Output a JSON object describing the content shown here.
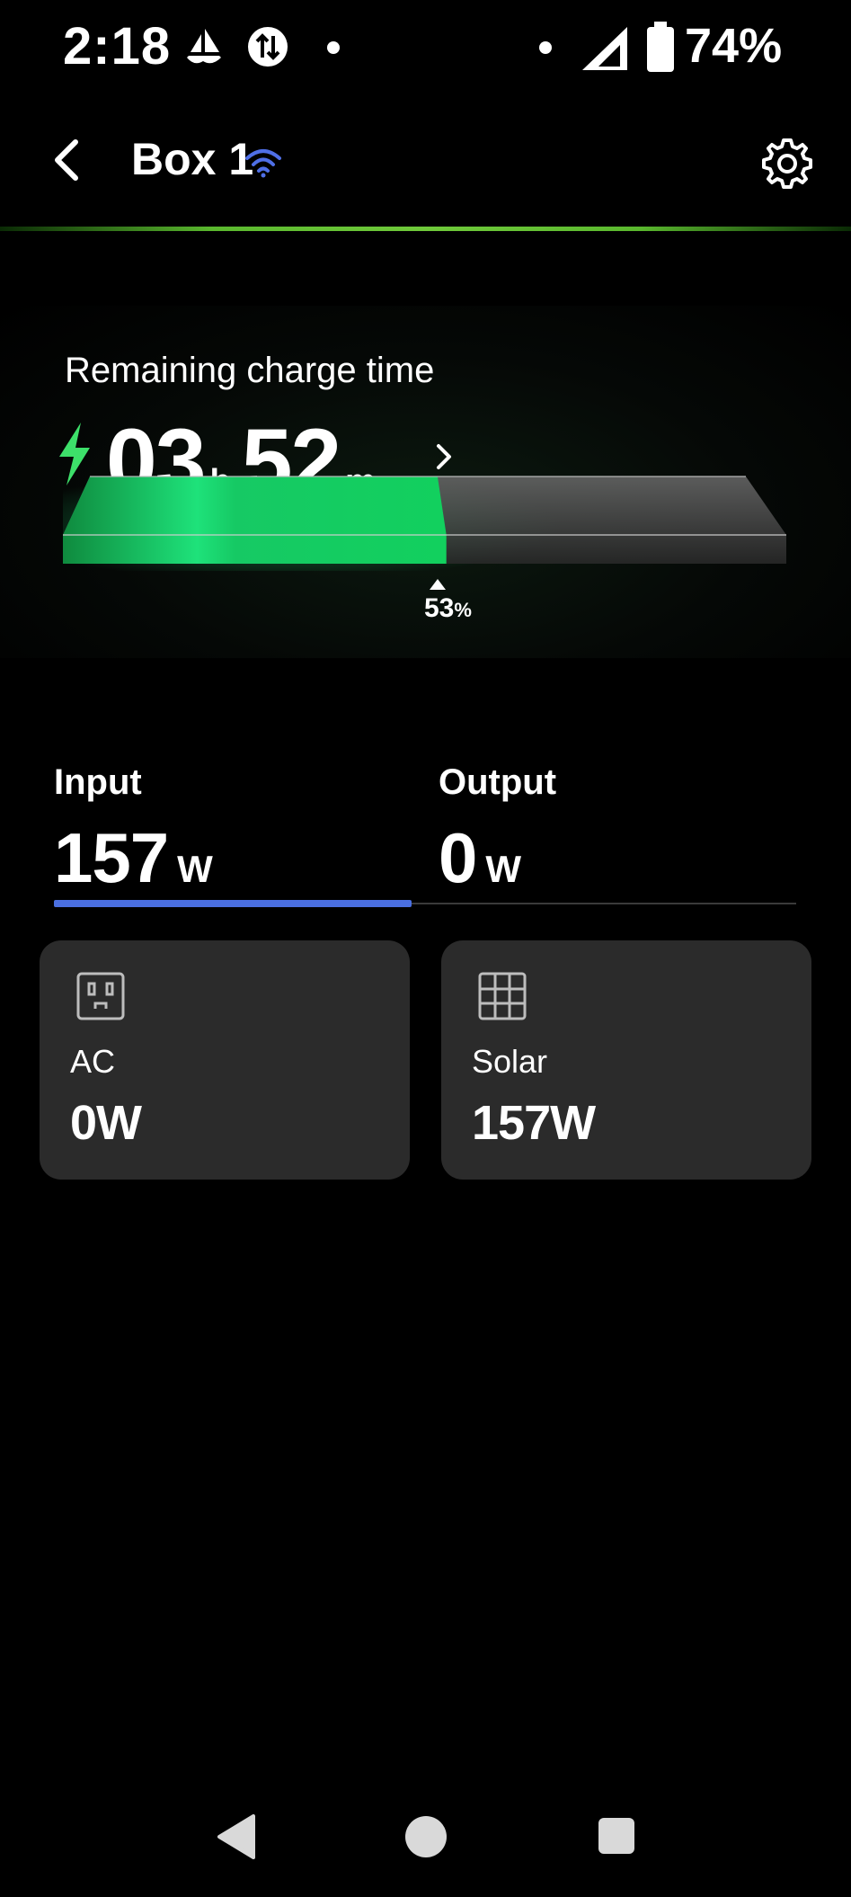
{
  "status_bar": {
    "time": "2:18",
    "battery_percent": "74%",
    "icons": [
      "sailing-icon",
      "data-sync-icon",
      "dot-icon",
      "dot-icon",
      "signal-icon",
      "battery-icon"
    ]
  },
  "header": {
    "title": "Box 1",
    "icons": [
      "back-arrow-icon",
      "wifi-icon",
      "gear-icon"
    ]
  },
  "charge": {
    "label": "Remaining charge time",
    "hours": "03",
    "hours_unit": "h",
    "minutes": "52",
    "minutes_unit": "m",
    "level_percent_value": "53",
    "level_percent_unit": "%",
    "level_fraction": 0.53
  },
  "tabs": {
    "input": {
      "label": "Input",
      "value": "157",
      "unit": "W"
    },
    "output": {
      "label": "Output",
      "value": "0",
      "unit": "W"
    },
    "active": "input"
  },
  "sources": [
    {
      "label": "AC",
      "value": "0W",
      "icon": "ac-outlet-icon"
    },
    {
      "label": "Solar",
      "value": "157W",
      "icon": "solar-panel-icon"
    }
  ],
  "colors": {
    "accent_green": "#3de06a",
    "tab_indicator": "#4a6fe0",
    "card_bg": "#2b2b2b",
    "wifi_blue": "#4f6fe6"
  },
  "nav_bar": {
    "icons": [
      "nav-back-icon",
      "nav-home-icon",
      "nav-recents-icon"
    ]
  }
}
